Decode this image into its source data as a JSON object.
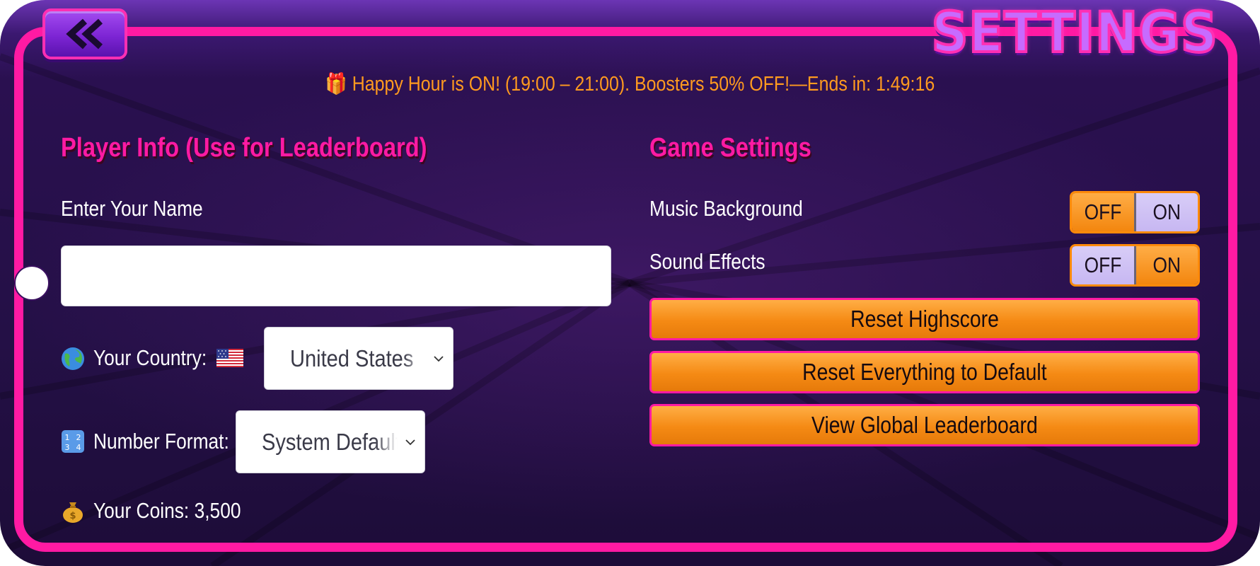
{
  "header": {
    "title": "SETTINGS",
    "back_icon": "double-chevron-left-icon"
  },
  "banner": {
    "text": "🎁 Happy Hour is ON! (19:00 – 21:00). Boosters 50% OFF!—Ends in: 1:49:16"
  },
  "player_info": {
    "heading": "Player Info (Use for Leaderboard)",
    "name_label": "Enter Your Name",
    "name_value": "",
    "name_placeholder": "",
    "country_label": "Your Country:",
    "country_value": "United States",
    "number_format_label": "Number Format:",
    "number_format_value": "System Default",
    "coins_label": "Your Coins: 3,500"
  },
  "game_settings": {
    "heading": "Game Settings",
    "music": {
      "label": "Music Background",
      "off_label": "OFF",
      "on_label": "ON",
      "state": "OFF"
    },
    "sound": {
      "label": "Sound Effects",
      "off_label": "OFF",
      "on_label": "ON",
      "state": "ON"
    },
    "buttons": {
      "reset_highscore": "Reset Highscore",
      "reset_everything": "Reset Everything to Default",
      "view_leaderboard": "View Global Leaderboard"
    }
  },
  "colors": {
    "accent_pink": "#ff1aa3",
    "accent_orange": "#f58a14",
    "banner_orange": "#ff9a1f",
    "toggle_lavender": "#c7b7f2",
    "background": "#241046"
  }
}
